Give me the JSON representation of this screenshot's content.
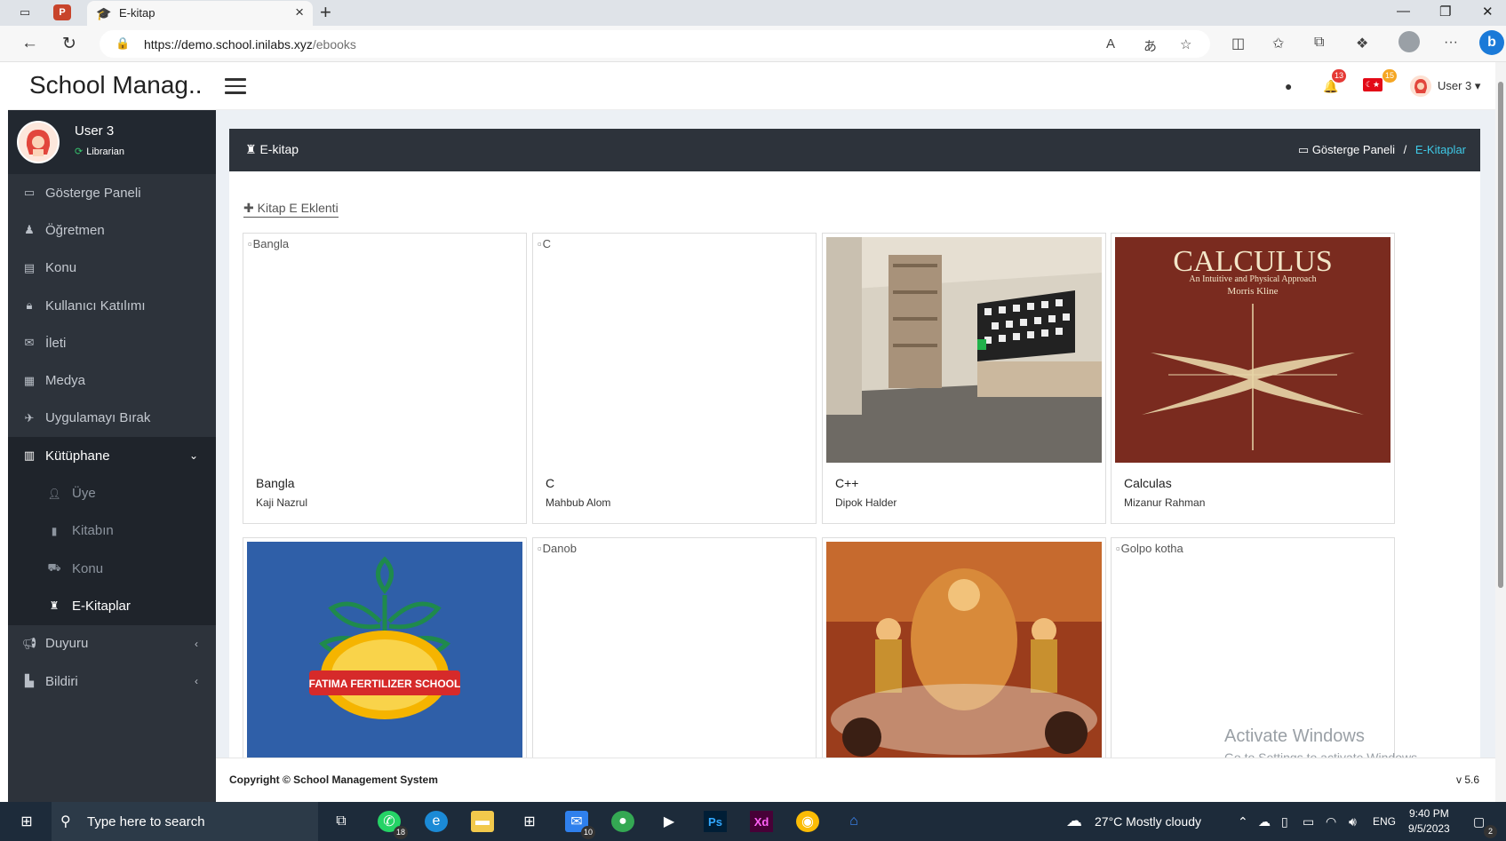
{
  "browser": {
    "tab_title": "E-kitap",
    "url_host": "https://demo.school.inilabs.xyz",
    "url_path": "/ebooks"
  },
  "header": {
    "brand": "School Manag..",
    "notif_count": "13",
    "flag_count": "15",
    "user_label": "User 3 ▾"
  },
  "sidebar": {
    "user_name": "User 3",
    "user_role": "Librarian",
    "items": [
      {
        "label": "Gösterge Paneli",
        "icon": "laptop-icon"
      },
      {
        "label": "Öğretmen",
        "icon": "teacher-icon"
      },
      {
        "label": "Konu",
        "icon": "book-icon"
      },
      {
        "label": "Kullanıcı Katılımı",
        "icon": "lock-icon"
      },
      {
        "label": "İleti",
        "icon": "envelope-icon"
      },
      {
        "label": "Medya",
        "icon": "film-icon"
      },
      {
        "label": "Uygulamayı Bırak",
        "icon": "leave-icon"
      },
      {
        "label": "Kütüphane",
        "icon": "library-icon"
      }
    ],
    "sub_items": [
      {
        "label": "Üye",
        "icon": "user-icon"
      },
      {
        "label": "Kitabın",
        "icon": "book-icon"
      },
      {
        "label": "Konu",
        "icon": "cart-icon"
      },
      {
        "label": "E-Kitaplar",
        "icon": "ebook-icon"
      }
    ],
    "bottom_items": [
      {
        "label": "Duyuru",
        "icon": "bullhorn-icon"
      },
      {
        "label": "Bildiri",
        "icon": "report-icon"
      }
    ]
  },
  "page": {
    "title": "E-kitap",
    "breadcrumb_home": "Gösterge Paneli",
    "breadcrumb_sep": "/",
    "breadcrumb_current": "E-Kitaplar",
    "add_link": "Kitap E Eklenti"
  },
  "books": [
    {
      "name": "Bangla",
      "author": "Kaji Nazrul",
      "alt": "Bangla",
      "cover": "broken"
    },
    {
      "name": "C",
      "author": "Mahbub Alom",
      "alt": "C",
      "cover": "broken"
    },
    {
      "name": "C++",
      "author": "Dipok Halder",
      "alt": "",
      "cover": "room"
    },
    {
      "name": "Calculas",
      "author": "Mizanur Rahman",
      "alt": "",
      "cover": "calculus"
    },
    {
      "name": "",
      "author": "",
      "alt": "",
      "cover": "school-logo"
    },
    {
      "name": "",
      "author": "",
      "alt": "Danob",
      "cover": "broken"
    },
    {
      "name": "",
      "author": "",
      "alt": "",
      "cover": "festival"
    },
    {
      "name": "",
      "author": "",
      "alt": "Golpo kotha",
      "cover": "broken"
    }
  ],
  "calculus_cover": {
    "title": "CALCULUS",
    "subtitle": "An Intuitive and Physical Approach",
    "author": "Morris Kline"
  },
  "school_logo": {
    "text": "FATIMA FERTILIZER SCHOOL"
  },
  "footer": {
    "copyright": "Copyright © School Management System",
    "version": "v 5.6"
  },
  "watermark": {
    "line1": "Activate Windows",
    "line2": "Go to Settings to activate Windows."
  },
  "taskbar": {
    "search_placeholder": "Type here to search",
    "weather": "27°C  Mostly cloudy",
    "lang": "ENG",
    "time": "9:40 PM",
    "date": "9/5/2023",
    "whatsapp_badge": "18",
    "mail_badge": "10",
    "notif_badge": "2"
  },
  "colors": {
    "sidebar": "#2d333b",
    "accent": "#3ec9e6",
    "badge_red": "#e53935",
    "badge_orange": "#f5a623"
  }
}
